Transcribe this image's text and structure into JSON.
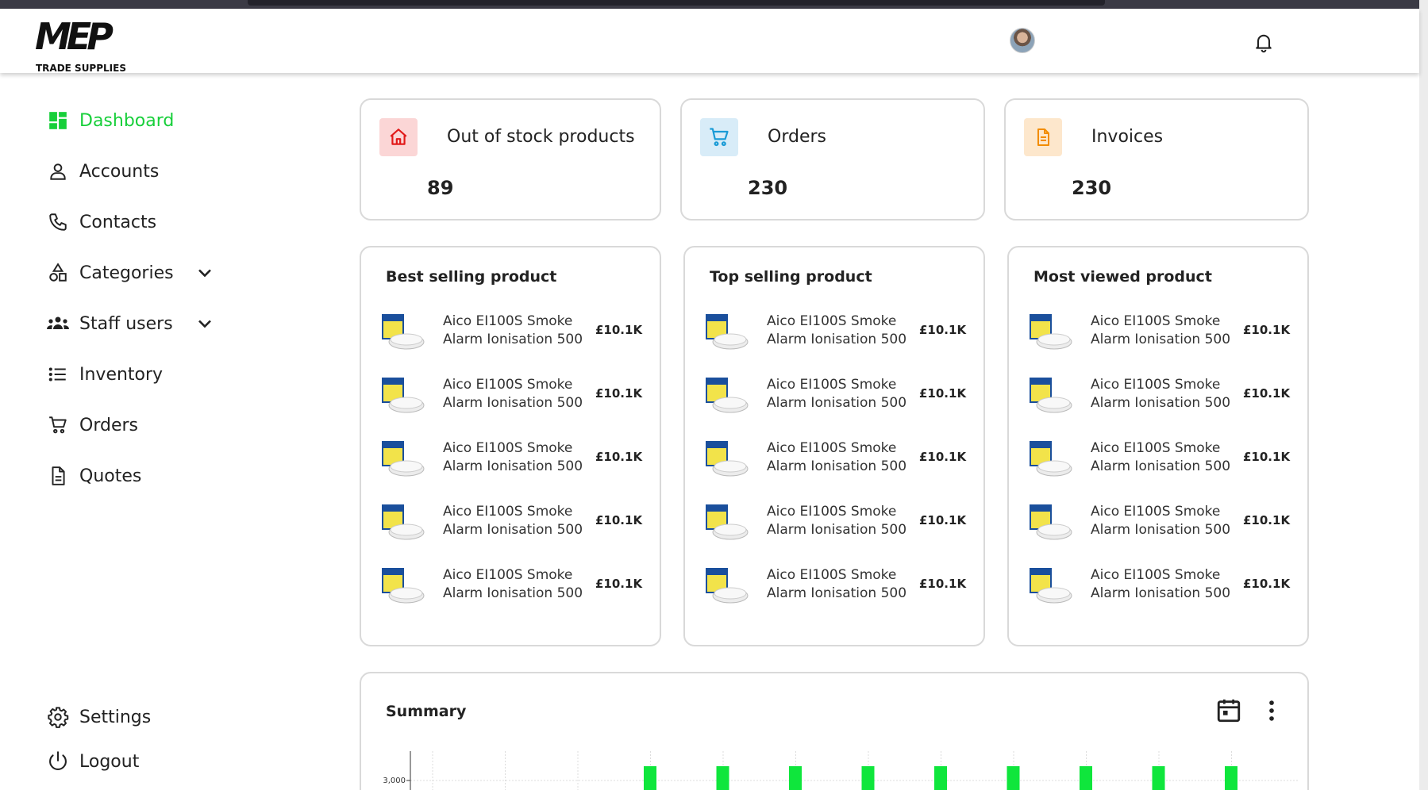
{
  "brand": {
    "logo_text": "MEP",
    "tagline": "TRADE SUPPLIES"
  },
  "header": {
    "avatar": "user-avatar",
    "notifications_icon": "bell-icon"
  },
  "colors": {
    "accent": "#17cf3a",
    "card_border": "#d9d9d9",
    "home_badge": "#fbd6d6",
    "cart_badge": "#d8ecf8",
    "invoice_badge": "#fde7cc"
  },
  "sidebar": {
    "items": [
      {
        "label": "Dashboard",
        "icon": "dashboard-icon",
        "active": true
      },
      {
        "label": "Accounts",
        "icon": "person-icon"
      },
      {
        "label": "Contacts",
        "icon": "phone-icon"
      },
      {
        "label": "Categories",
        "icon": "shapes-icon",
        "expandable": true
      },
      {
        "label": "Staff users",
        "icon": "group-icon",
        "expandable": true
      },
      {
        "label": "Inventory",
        "icon": "list-icon"
      },
      {
        "label": "Orders",
        "icon": "cart-icon"
      },
      {
        "label": "Quotes",
        "icon": "document-icon"
      }
    ],
    "bottom": [
      {
        "label": "Settings",
        "icon": "gear-icon"
      },
      {
        "label": "Logout",
        "icon": "power-icon"
      }
    ]
  },
  "stats": [
    {
      "title": "Out of stock products",
      "value": "89",
      "icon": "home-icon"
    },
    {
      "title": "Orders",
      "value": "230",
      "icon": "cart-icon"
    },
    {
      "title": "Invoices",
      "value": "230",
      "icon": "invoice-icon"
    }
  ],
  "product_lists": [
    {
      "title": "Best selling product",
      "items": [
        {
          "name": "Aico EI100S Smoke Alarm Ionisation 500",
          "price": "£10.1K"
        },
        {
          "name": "Aico EI100S Smoke Alarm Ionisation 500",
          "price": "£10.1K"
        },
        {
          "name": "Aico EI100S Smoke Alarm Ionisation 500",
          "price": "£10.1K"
        },
        {
          "name": "Aico EI100S Smoke Alarm Ionisation 500",
          "price": "£10.1K"
        },
        {
          "name": "Aico EI100S Smoke Alarm Ionisation 500",
          "price": "£10.1K"
        }
      ]
    },
    {
      "title": "Top selling product",
      "items": [
        {
          "name": "Aico EI100S Smoke Alarm Ionisation 500",
          "price": "£10.1K"
        },
        {
          "name": "Aico EI100S Smoke Alarm Ionisation 500",
          "price": "£10.1K"
        },
        {
          "name": "Aico EI100S Smoke Alarm Ionisation 500",
          "price": "£10.1K"
        },
        {
          "name": "Aico EI100S Smoke Alarm Ionisation 500",
          "price": "£10.1K"
        },
        {
          "name": "Aico EI100S Smoke Alarm Ionisation 500",
          "price": "£10.1K"
        }
      ]
    },
    {
      "title": "Most viewed product",
      "items": [
        {
          "name": "Aico EI100S Smoke Alarm Ionisation 500",
          "price": "£10.1K"
        },
        {
          "name": "Aico EI100S Smoke Alarm Ionisation 500",
          "price": "£10.1K"
        },
        {
          "name": "Aico EI100S Smoke Alarm Ionisation 500",
          "price": "£10.1K"
        },
        {
          "name": "Aico EI100S Smoke Alarm Ionisation 500",
          "price": "£10.1K"
        },
        {
          "name": "Aico EI100S Smoke Alarm Ionisation 500",
          "price": "£10.1K"
        }
      ]
    }
  ],
  "summary": {
    "title": "Summary",
    "calendar_icon": "calendar-icon",
    "more_icon": "more-vertical-icon"
  },
  "chart_data": {
    "type": "bar",
    "ytick_labels": [
      "3,000"
    ],
    "bar_color": "#0fe63c",
    "grid": true,
    "bar_count_visible": 9,
    "note_visible_range": "chart cropped at bottom of viewport; only tops of bars visible above 3,000"
  }
}
